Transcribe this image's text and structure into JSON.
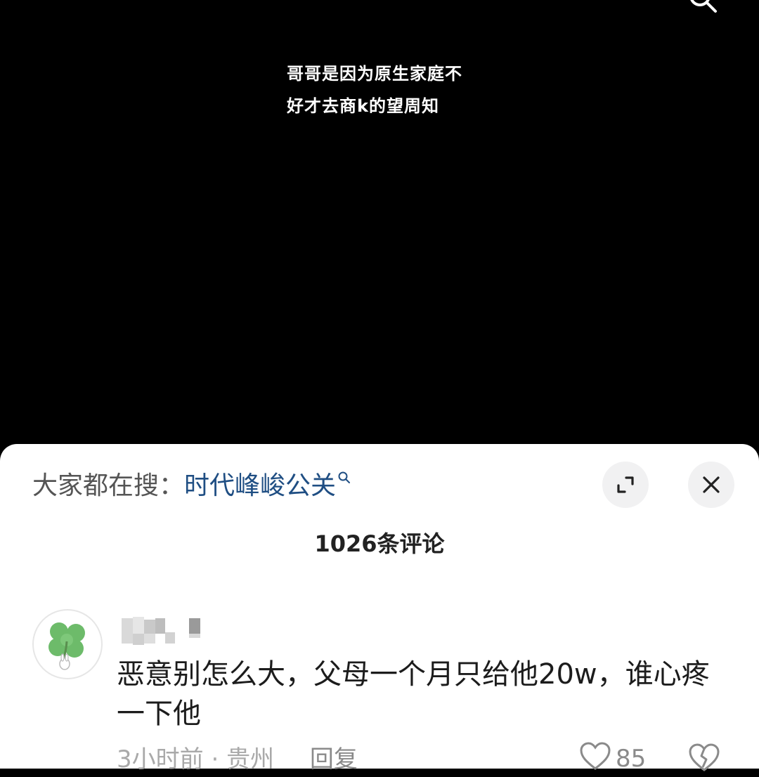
{
  "video": {
    "caption_line1": "哥哥是因为原生家庭不",
    "caption_line2": "好才去商k的望周知",
    "top_icon": "search-icon"
  },
  "sheet": {
    "search_prefix": "大家都在搜：",
    "search_term": "时代峰峻公关",
    "expand_icon": "expand-icon",
    "close_icon": "close-icon",
    "comment_count": "1026条评论"
  },
  "comment": {
    "text": "恶意别怎么大，父母一个月只给他20w，谁心疼一下他",
    "time": "3小时前",
    "separator": "·",
    "location": "贵州",
    "reply_label": "回复",
    "like_count": "85",
    "avatar_icon": "clover-avatar-icon"
  },
  "colors": {
    "background": "#000000",
    "sheet": "#ffffff",
    "link": "#1f4e83",
    "meta": "#a9a9a9"
  }
}
